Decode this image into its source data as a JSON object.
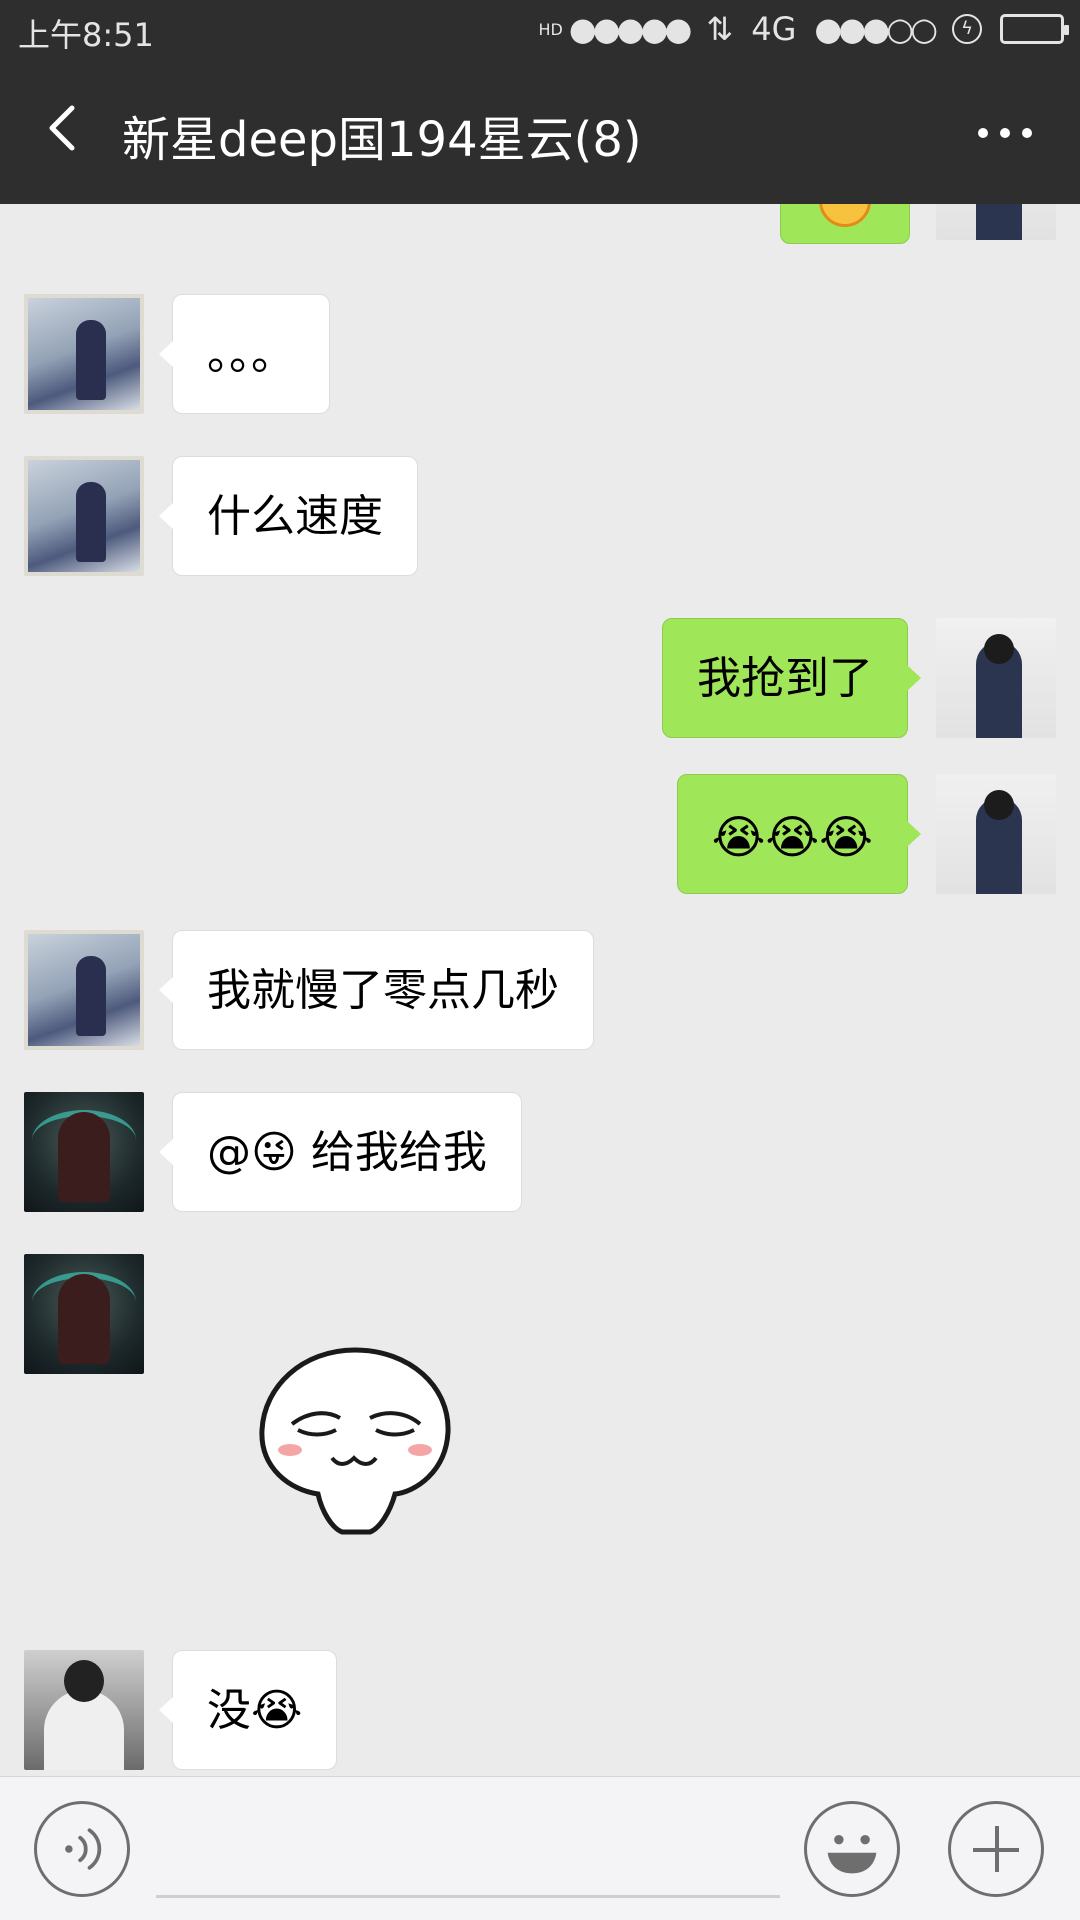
{
  "status_bar": {
    "time": "上午8:51",
    "hd_label": "HD",
    "network": "4G",
    "icons": [
      "signal-icon",
      "data-arrows-icon",
      "network-4g-icon",
      "wifi-signal-icon",
      "charging-icon",
      "battery-icon"
    ]
  },
  "nav": {
    "title": "新星deep国194星云(8)",
    "back_icon": "chevron-left-icon",
    "more_icon": "more-horizontal-icon"
  },
  "messages": [
    {
      "side": "out",
      "type": "partial",
      "text": ""
    },
    {
      "side": "in",
      "sender": "a",
      "text": "。。。"
    },
    {
      "side": "in",
      "sender": "a",
      "text": "什么速度"
    },
    {
      "side": "out",
      "sender": "me",
      "text": "我抢到了"
    },
    {
      "side": "out",
      "sender": "me",
      "text": "😭😭😭"
    },
    {
      "side": "in",
      "sender": "a",
      "text": "我就慢了零点几秒"
    },
    {
      "side": "in",
      "sender": "c",
      "text": "@😜 给我给我"
    },
    {
      "side": "in",
      "sender": "c",
      "type": "sticker",
      "sticker": "smug-face-sticker"
    },
    {
      "side": "in",
      "sender": "d",
      "text": "没😭"
    }
  ],
  "input_bar": {
    "voice_icon": "voice-icon",
    "emoji_icon": "emoji-icon",
    "plus_icon": "plus-icon"
  },
  "colors": {
    "bar": "#2e2e2e",
    "chat_bg": "#ebebeb",
    "bubble_out": "#9fe658",
    "bubble_in": "#ffffff"
  }
}
